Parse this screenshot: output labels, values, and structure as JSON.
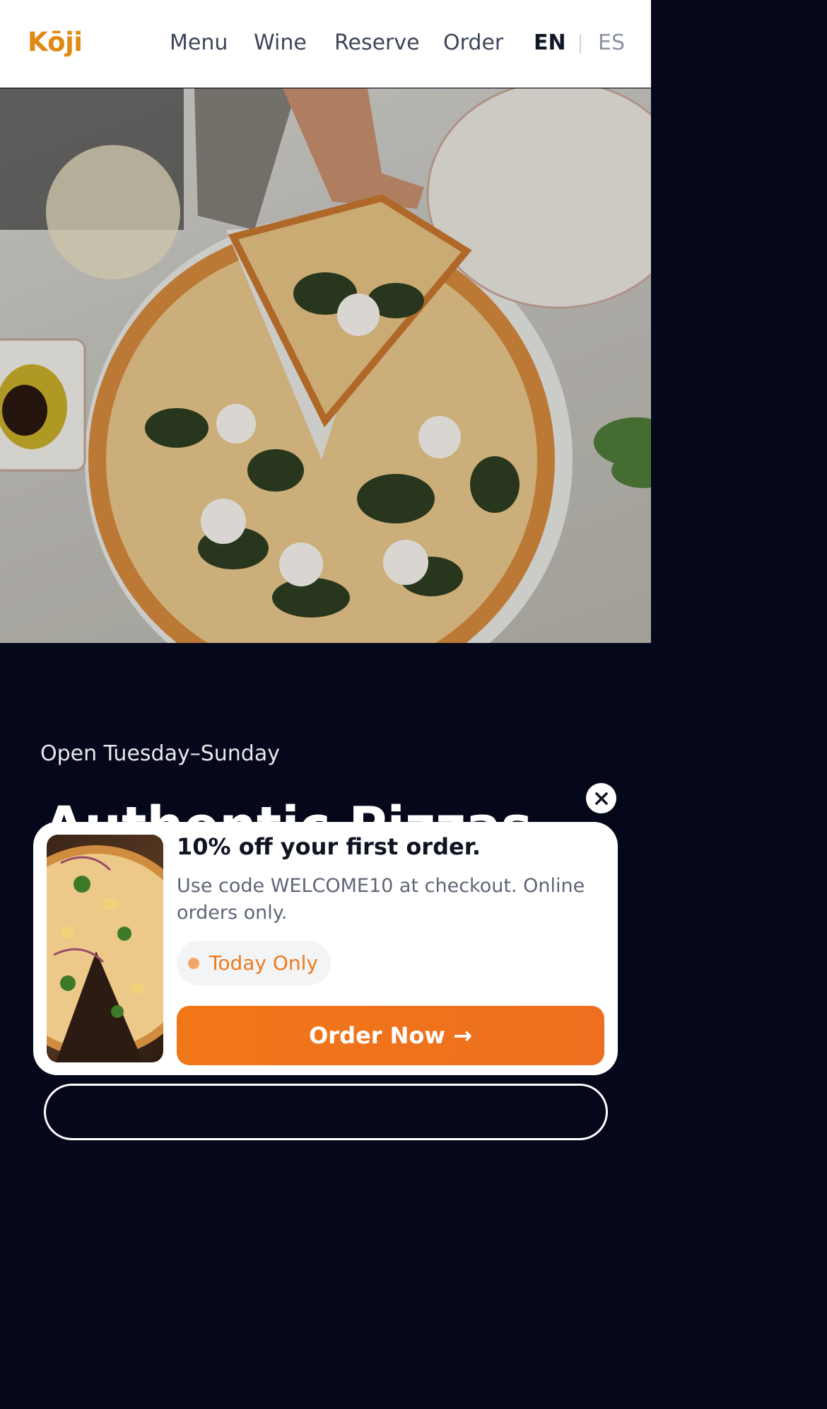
{
  "nav": {
    "logo": "Kōji",
    "links": [
      "Menu",
      "Wine",
      "Reserve",
      "Order"
    ],
    "lang_active": "EN",
    "lang_other": "ES"
  },
  "hero": {
    "image": "pizza-on-table-photo"
  },
  "info": {
    "open": "Open Tuesday–Sunday",
    "headline": "Authentic Pizzas"
  },
  "promo": {
    "title": "10% off your first order.",
    "body": "Use code WELCOME10 at checkout. Online orders only.",
    "badge": "Today Only",
    "cta": "Order Now →",
    "colors": {
      "accent": "#EE7218",
      "badge_text": "#EE7B1D",
      "logo": "#E08A14"
    }
  }
}
